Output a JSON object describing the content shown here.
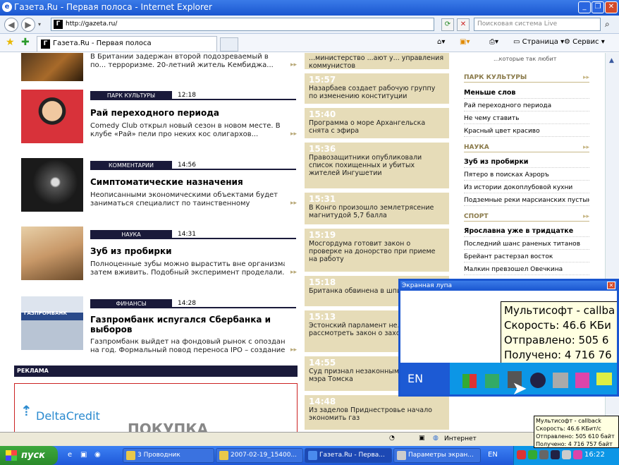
{
  "window": {
    "title": "Газета.Ru - Первая полоса - Internet Explorer"
  },
  "address": {
    "url": "http://gazeta.ru/",
    "search_placeholder": "Поисковая система Live"
  },
  "tab": {
    "label": "Газета.Ru - Первая полоса"
  },
  "commands": {
    "page": "Страница",
    "service": "Сервис"
  },
  "articles": [
    {
      "section": "",
      "time": "",
      "title": "",
      "desc1": "В Британии задержан второй подозреваемый в",
      "desc2": "по... терроризме. 20-летний житель Кембиджа..."
    },
    {
      "section": "ПАРК КУЛЬТУРЫ",
      "time": "12:18",
      "title": "Рай переходного периода",
      "desc1": "Comedy Club открыл новый сезон в новом месте. В",
      "desc2": "клубе «Рай» пели про неких кос олигархов..."
    },
    {
      "section": "КОММЕНТАРИИ",
      "time": "14:56",
      "title": "Симптоматические назначения",
      "desc1": "Неописанными экономическими объектами будет",
      "desc2": "заниматься специалист по таинственному"
    },
    {
      "section": "НАУКА",
      "time": "14:31",
      "title": "Зуб из пробирки",
      "desc1": "Полноценные зубы можно вырастить вне организма и",
      "desc2": "затем вживить. Подобный эксперимент проделали..."
    },
    {
      "section": "ФИНАНСЫ",
      "time": "14:28",
      "title": "Газпромбанк испугался Сбербанка и выборов",
      "desc1": "Газпромбанк выйдет на фондовый рынок с опозданием",
      "desc2": "на год. Формальный повод переноса IPO – создание..."
    }
  ],
  "ad": {
    "label": "РЕКЛАМА",
    "brand": "DeltaCredit",
    "text": "ПОКУПКА"
  },
  "news": [
    {
      "time": "",
      "text": "...министерство ...ают у... управления коммунистов"
    },
    {
      "time": "15:57",
      "text": "Назарбаев создает рабочую группу по изменению конституции"
    },
    {
      "time": "15:40",
      "text": "Программа о море Архангельска снята с эфира"
    },
    {
      "time": "15:36",
      "text": "Правозащитники опубликовали список похищенных и убитых жителей Ингушетии"
    },
    {
      "time": "15:31",
      "text": "В Конго произошло землетрясение магнитудой 5,7 балла"
    },
    {
      "time": "15:19",
      "text": "Мосгордума готовит закон о проверке на донорство при приеме на работу"
    },
    {
      "time": "15:18",
      "text": "Британка обвинена в шпи... Анголе"
    },
    {
      "time": "15:13",
      "text": "Эстонский парламент не... заново рассмотреть закон о захоронениях"
    },
    {
      "time": "14:55",
      "text": "Суд признал незаконным... адвоката мэра Томска"
    },
    {
      "time": "14:48",
      "text": "Из заделов Приднестровье начало экономить газ"
    }
  ],
  "right": {
    "top_text": "...которые так любит",
    "sections": [
      {
        "name": "ПАРК КУЛЬТУРЫ",
        "links": [
          "Меньше слов",
          "Рай переходного периода",
          "Не чему ставить",
          "Красный цвет красиво"
        ]
      },
      {
        "name": "НАУКА",
        "links": [
          "Зуб из пробирки",
          "Пятеро в поисках Аэроръ",
          "Из истории докоплубовой кухни",
          "Подземные реки марсианских пустынь"
        ]
      },
      {
        "name": "СПОРТ",
        "links": [
          "Ярославна уже в тридцатке",
          "Последний шанс раненых титанов",
          "Брейант растерзал восток",
          "Малкин превзошел Овечкина"
        ]
      }
    ]
  },
  "statusbar": {
    "zone": "Интернет"
  },
  "taskbar": {
    "start": "пуск",
    "buttons": [
      "3 Проводник",
      "2007-02-19_15400...",
      "Газета.Ru - Перва...",
      "Параметры экран..."
    ],
    "lang": "EN",
    "clock": "16:22"
  },
  "magnifier": {
    "title": "Экранная лупа",
    "lines": [
      "Мультисофт - callba",
      "Скорость: 46.6 КБи",
      "Отправлено: 505 6",
      "Получено: 4 716 76"
    ],
    "lang": "EN"
  },
  "tooltip": {
    "lines": [
      "Мультисофт - callback",
      "Скорость: 46.6 КБит/с",
      "Отправлено: 505 610 байт",
      "Получено: 4 716 757 байт"
    ]
  }
}
